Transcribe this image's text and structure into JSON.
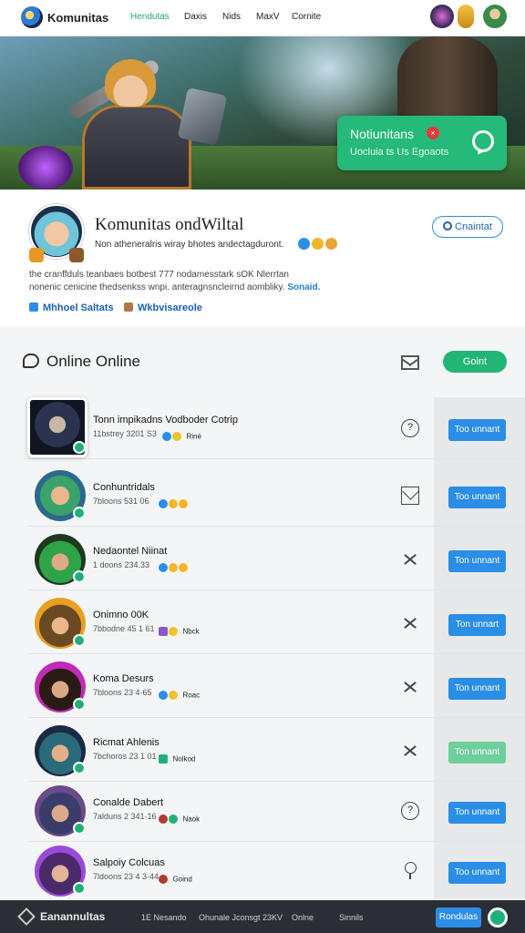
{
  "app": {
    "name": "Komunitas"
  },
  "nav": [
    "Hendutas",
    "Daxis",
    "Nids",
    "MaxV",
    "Cornite"
  ],
  "banner": {
    "card_title": "Notiunitans",
    "card_badge": "×",
    "card_sub": "Uocluia ts Us Egoaots"
  },
  "profile": {
    "name": "Komunitas ondWiltal",
    "desc": "Non atheneralris wiray bhotes andectagduront.",
    "bio_line1": "the cranffduls teanbaes botbest 777 nodamesstark sOK Nlerrtan",
    "bio_line2": "nonenic cenicine thedsenkss wnpi. anteragnsncleirnd aombliky.",
    "bio_link": "Sonaid.",
    "contact_label": "Cnaintat",
    "meta1": "Mhhoel Saltats",
    "meta2": "Wkbvisareole"
  },
  "online": {
    "title": "Online Online",
    "button": "Goint"
  },
  "members": [
    {
      "name": "Tonn impikadns Vodboder Cotrip",
      "sub": "11bstrey 3201 S3",
      "chip_label": "Riné",
      "action": "question",
      "button": "Too unnant",
      "btn_style": "blue"
    },
    {
      "name": "Conhuntridals",
      "sub": "7bloons 531 06",
      "chip_label": "",
      "action": "envelope",
      "button": "Too unnant",
      "btn_style": "blue"
    },
    {
      "name": "Nedaontel Niinat",
      "sub": "1 doons 234.33",
      "chip_label": "",
      "action": "cross",
      "button": "Ton unnant",
      "btn_style": "blue"
    },
    {
      "name": "Onimno 00K",
      "sub": "7bbodne 45 1 61",
      "chip_label": "Nbck",
      "action": "cross",
      "button": "Ton unnart",
      "btn_style": "blue"
    },
    {
      "name": "Koma Desurs",
      "sub": "7bloons 23 4·65",
      "chip_label": "Roac",
      "action": "cross",
      "button": "Ton unnant",
      "btn_style": "blue"
    },
    {
      "name": "Ricmat Ahlenis",
      "sub": "7bchoros 23 1 01",
      "chip_label": "Nolkod",
      "action": "cross",
      "button": "Ton unnant",
      "btn_style": "green"
    },
    {
      "name": "Conalde Dabert",
      "sub": "7alduns 2 341·16",
      "chip_label": "Naok",
      "action": "question",
      "button": "Ton unnant",
      "btn_style": "blue"
    },
    {
      "name": "Salpoiy Colcuas",
      "sub": "7ldoons 23 4 3·44",
      "chip_label": "Goind",
      "action": "pin",
      "button": "Too unnant",
      "btn_style": "blue"
    }
  ],
  "footer": {
    "title": "Eanannultas",
    "items": [
      "1E Nesando",
      "Ohunale Jconsgt 23KV",
      "Onlne",
      "Sinnils"
    ],
    "button": "Rondulas"
  }
}
